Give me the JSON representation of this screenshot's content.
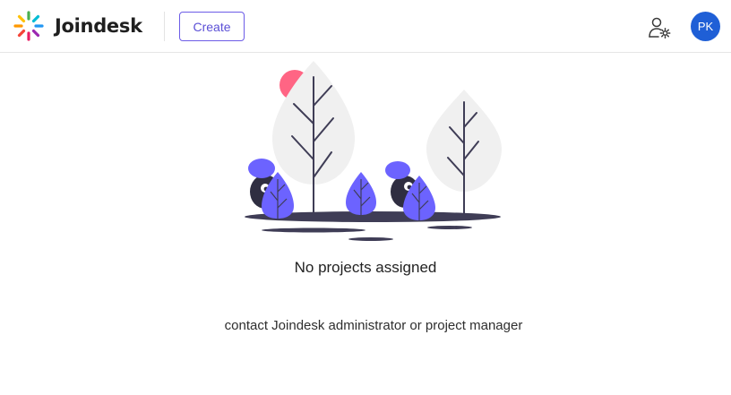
{
  "header": {
    "brand": "Joindesk",
    "create_label": "Create",
    "avatar_initials": "PK"
  },
  "icons": {
    "logo": "joindesk-logo-icon",
    "user_settings": "user-settings-icon"
  },
  "empty_state": {
    "title": "No projects assigned",
    "subtitle": "contact Joindesk administrator or project manager"
  },
  "colors": {
    "accent": "#6c5ce7",
    "avatar": "#1f5fd6",
    "illustration_purple": "#6c63ff",
    "sun": "#ff6584"
  }
}
